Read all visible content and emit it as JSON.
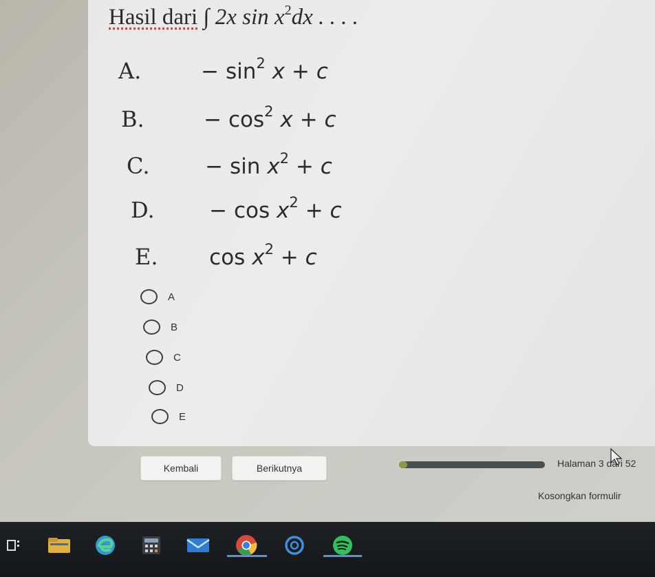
{
  "question": {
    "prefix": "Hasil dari",
    "integral": "∫",
    "body_a": "2x sin x",
    "exp": "2",
    "body_b": "dx . . . ."
  },
  "options": [
    {
      "letter": "A.",
      "sign": "− sin",
      "exp1": "2",
      "var": "x",
      "mid": "",
      "exp2": "",
      "tail": "+ c"
    },
    {
      "letter": "B.",
      "sign": "− cos",
      "exp1": "2",
      "var": "x",
      "mid": "",
      "exp2": "",
      "tail": "+ c"
    },
    {
      "letter": "C.",
      "sign": "− sin",
      "exp1": "",
      "var": "x",
      "mid": "",
      "exp2": "2",
      "tail": "+ c"
    },
    {
      "letter": "D.",
      "sign": "− cos",
      "exp1": "",
      "var": "x",
      "mid": "",
      "exp2": "2",
      "tail": "+ c"
    },
    {
      "letter": "E.",
      "sign": "cos",
      "exp1": "",
      "var": "x",
      "mid": "",
      "exp2": "2",
      "tail": "+ c"
    }
  ],
  "choices": [
    {
      "label": "A"
    },
    {
      "label": "B"
    },
    {
      "label": "C"
    },
    {
      "label": "D"
    },
    {
      "label": "E"
    }
  ],
  "nav": {
    "back_label": "Kembali",
    "next_label": "Berikutnya",
    "progress_fraction": 0.0577,
    "page_text": "Halaman 3 dari 52",
    "clear_label": "Kosongkan formulir"
  },
  "taskbar": {
    "icons": [
      "task-view-icon",
      "file-explorer-icon",
      "edge-icon",
      "calculator-icon",
      "mail-icon",
      "chrome-icon",
      "cortana-icon",
      "spotify-icon"
    ]
  },
  "colors": {
    "card": "#ebebea",
    "text": "#2a2a2e",
    "taskbar": "#1a1c20",
    "progress_track": "#4a4f52",
    "progress_fill": "#8a9a40"
  }
}
